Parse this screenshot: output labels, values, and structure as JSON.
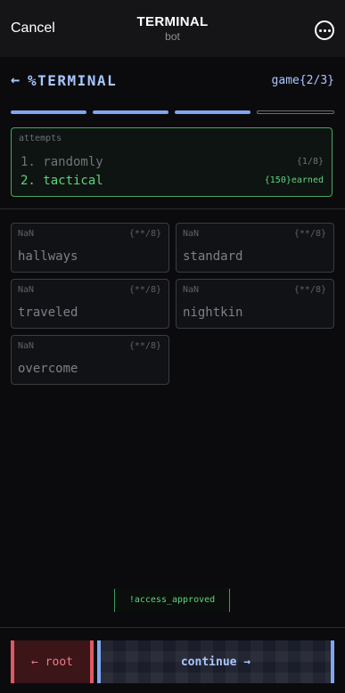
{
  "nav": {
    "cancel": "Cancel",
    "title": "TERMINAL",
    "subtitle": "bot"
  },
  "header": {
    "back_glyph": "←",
    "title": "%TERMINAL",
    "game_count": "game{2/3}"
  },
  "progress": {
    "completed": 3,
    "total": 4
  },
  "attempts": {
    "label": "attempts",
    "rows": [
      {
        "text": "1. randomly",
        "meta": "{1/8}"
      },
      {
        "text": "2. tactical",
        "meta": "{150}earned"
      }
    ]
  },
  "cards": [
    {
      "nan": "NaN",
      "score": "{**/8}",
      "word": "hallways"
    },
    {
      "nan": "NaN",
      "score": "{**/8}",
      "word": "standard"
    },
    {
      "nan": "NaN",
      "score": "{**/8}",
      "word": "traveled"
    },
    {
      "nan": "NaN",
      "score": "{**/8}",
      "word": "nightkin"
    },
    {
      "nan": "NaN",
      "score": "{**/8}",
      "word": "overcome"
    }
  ],
  "status": {
    "access": "!access_approved"
  },
  "buttons": {
    "root": "← root",
    "continue": "continue →"
  },
  "colors": {
    "accent_blue": "#a9c7ff",
    "success_green": "#5dd47f",
    "danger_red": "#e05864"
  },
  "icons": [
    "back-arrow-icon",
    "more-options-icon"
  ]
}
